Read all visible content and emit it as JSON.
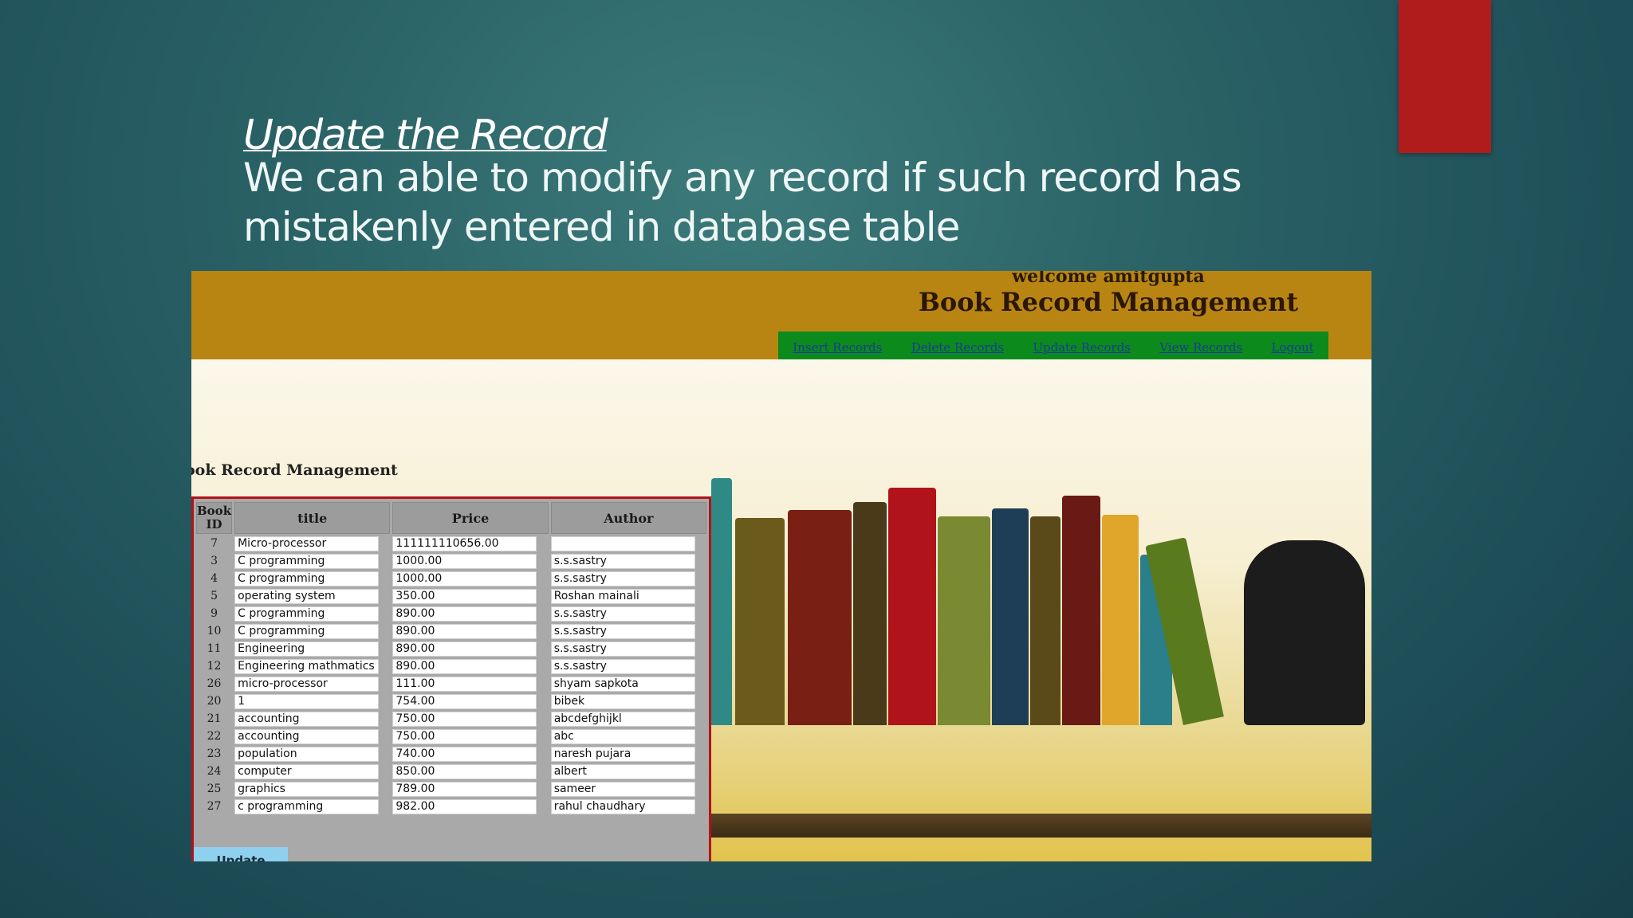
{
  "slide": {
    "title": "Update the Record",
    "body": "We can able to modify any record if such record has mistakenly entered in database table"
  },
  "app": {
    "welcome": "welcome amitgupta",
    "title": "Book Record Management",
    "nav": [
      "Insert Records",
      "Delete Records",
      "Update Records",
      "View Records",
      "Logout"
    ],
    "section_title": "ook Record Management",
    "table": {
      "headers": [
        "Book ID",
        "title",
        "Price",
        "Author"
      ],
      "rows": [
        [
          "7",
          "Micro-processor",
          "111111110656.00",
          ""
        ],
        [
          "3",
          "C programming",
          "1000.00",
          "s.s.sastry"
        ],
        [
          "4",
          "C programming",
          "1000.00",
          "s.s.sastry"
        ],
        [
          "5",
          "operating system",
          "350.00",
          "Roshan mainali"
        ],
        [
          "9",
          "C programming",
          "890.00",
          "s.s.sastry"
        ],
        [
          "10",
          "C programming",
          "890.00",
          "s.s.sastry"
        ],
        [
          "11",
          "Engineering",
          "890.00",
          "s.s.sastry"
        ],
        [
          "12",
          "Engineering mathmatics",
          "890.00",
          "s.s.sastry"
        ],
        [
          "26",
          "micro-processor",
          "111.00",
          "shyam sapkota"
        ],
        [
          "20",
          "1",
          "754.00",
          "bibek"
        ],
        [
          "21",
          "accounting",
          "750.00",
          "abcdefghijkl"
        ],
        [
          "22",
          "accounting",
          "750.00",
          "abc"
        ],
        [
          "23",
          "population",
          "740.00",
          "naresh pujara"
        ],
        [
          "24",
          "computer",
          "850.00",
          "albert"
        ],
        [
          "25",
          "graphics",
          "789.00",
          "sameer"
        ],
        [
          "27",
          "c programming",
          "982.00",
          "rahul chaudhary"
        ]
      ]
    },
    "update_label": "Update"
  },
  "colors": {
    "header": "#b98512",
    "nav": "#0c8a1c",
    "table_border": "#b3121a",
    "update_button": "#8fd0ee",
    "accent_tab": "#b01c1c"
  }
}
